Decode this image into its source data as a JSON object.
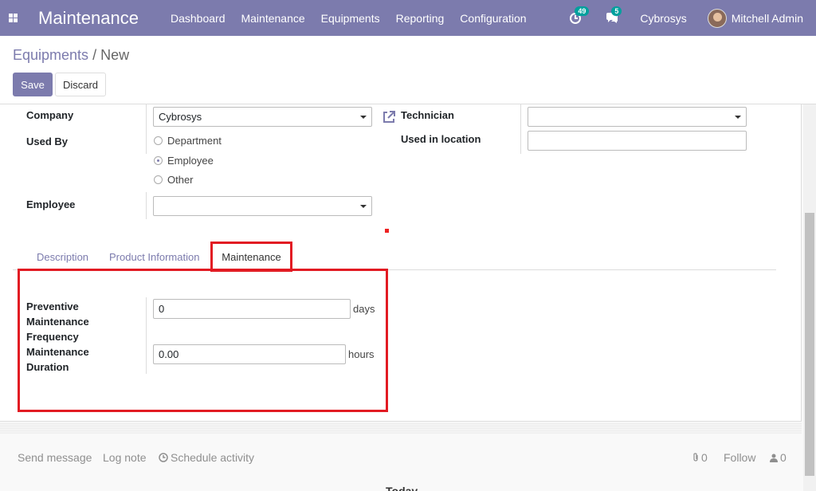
{
  "navbar": {
    "brand": "Maintenance",
    "menu": [
      "Dashboard",
      "Maintenance",
      "Equipments",
      "Reporting",
      "Configuration"
    ],
    "activity_count": "49",
    "message_count": "5",
    "company": "Cybrosys",
    "user": "Mitchell Admin"
  },
  "breadcrumb": {
    "parent": "Equipments",
    "separator": "/",
    "current": "New"
  },
  "buttons": {
    "save": "Save",
    "discard": "Discard"
  },
  "form": {
    "company_label": "Company",
    "company_value": "Cybrosys",
    "used_by_label": "Used By",
    "used_by_options": [
      "Department",
      "Employee",
      "Other"
    ],
    "used_by_selected": "Employee",
    "employee_label": "Employee",
    "employee_value": "",
    "technician_label": "Technician",
    "technician_value": "",
    "location_label": "Used in location",
    "location_value": ""
  },
  "tabs": {
    "description": "Description",
    "product_info": "Product Information",
    "maintenance": "Maintenance"
  },
  "maintenance": {
    "frequency_label_lines": [
      "Preventive",
      "Maintenance",
      "Frequency"
    ],
    "frequency_value": "0",
    "frequency_unit": "days",
    "duration_label_lines": [
      "Maintenance",
      "Duration"
    ],
    "duration_value": "0.00",
    "duration_unit": "hours"
  },
  "chatter": {
    "send_message": "Send message",
    "log_note": "Log note",
    "schedule_activity": "Schedule activity",
    "attachments": "0",
    "follow": "Follow",
    "followers": "0",
    "today": "Today"
  },
  "colors": {
    "navbar": "#7c7bad",
    "highlight": "#e21b23",
    "badge": "#00a09d"
  }
}
